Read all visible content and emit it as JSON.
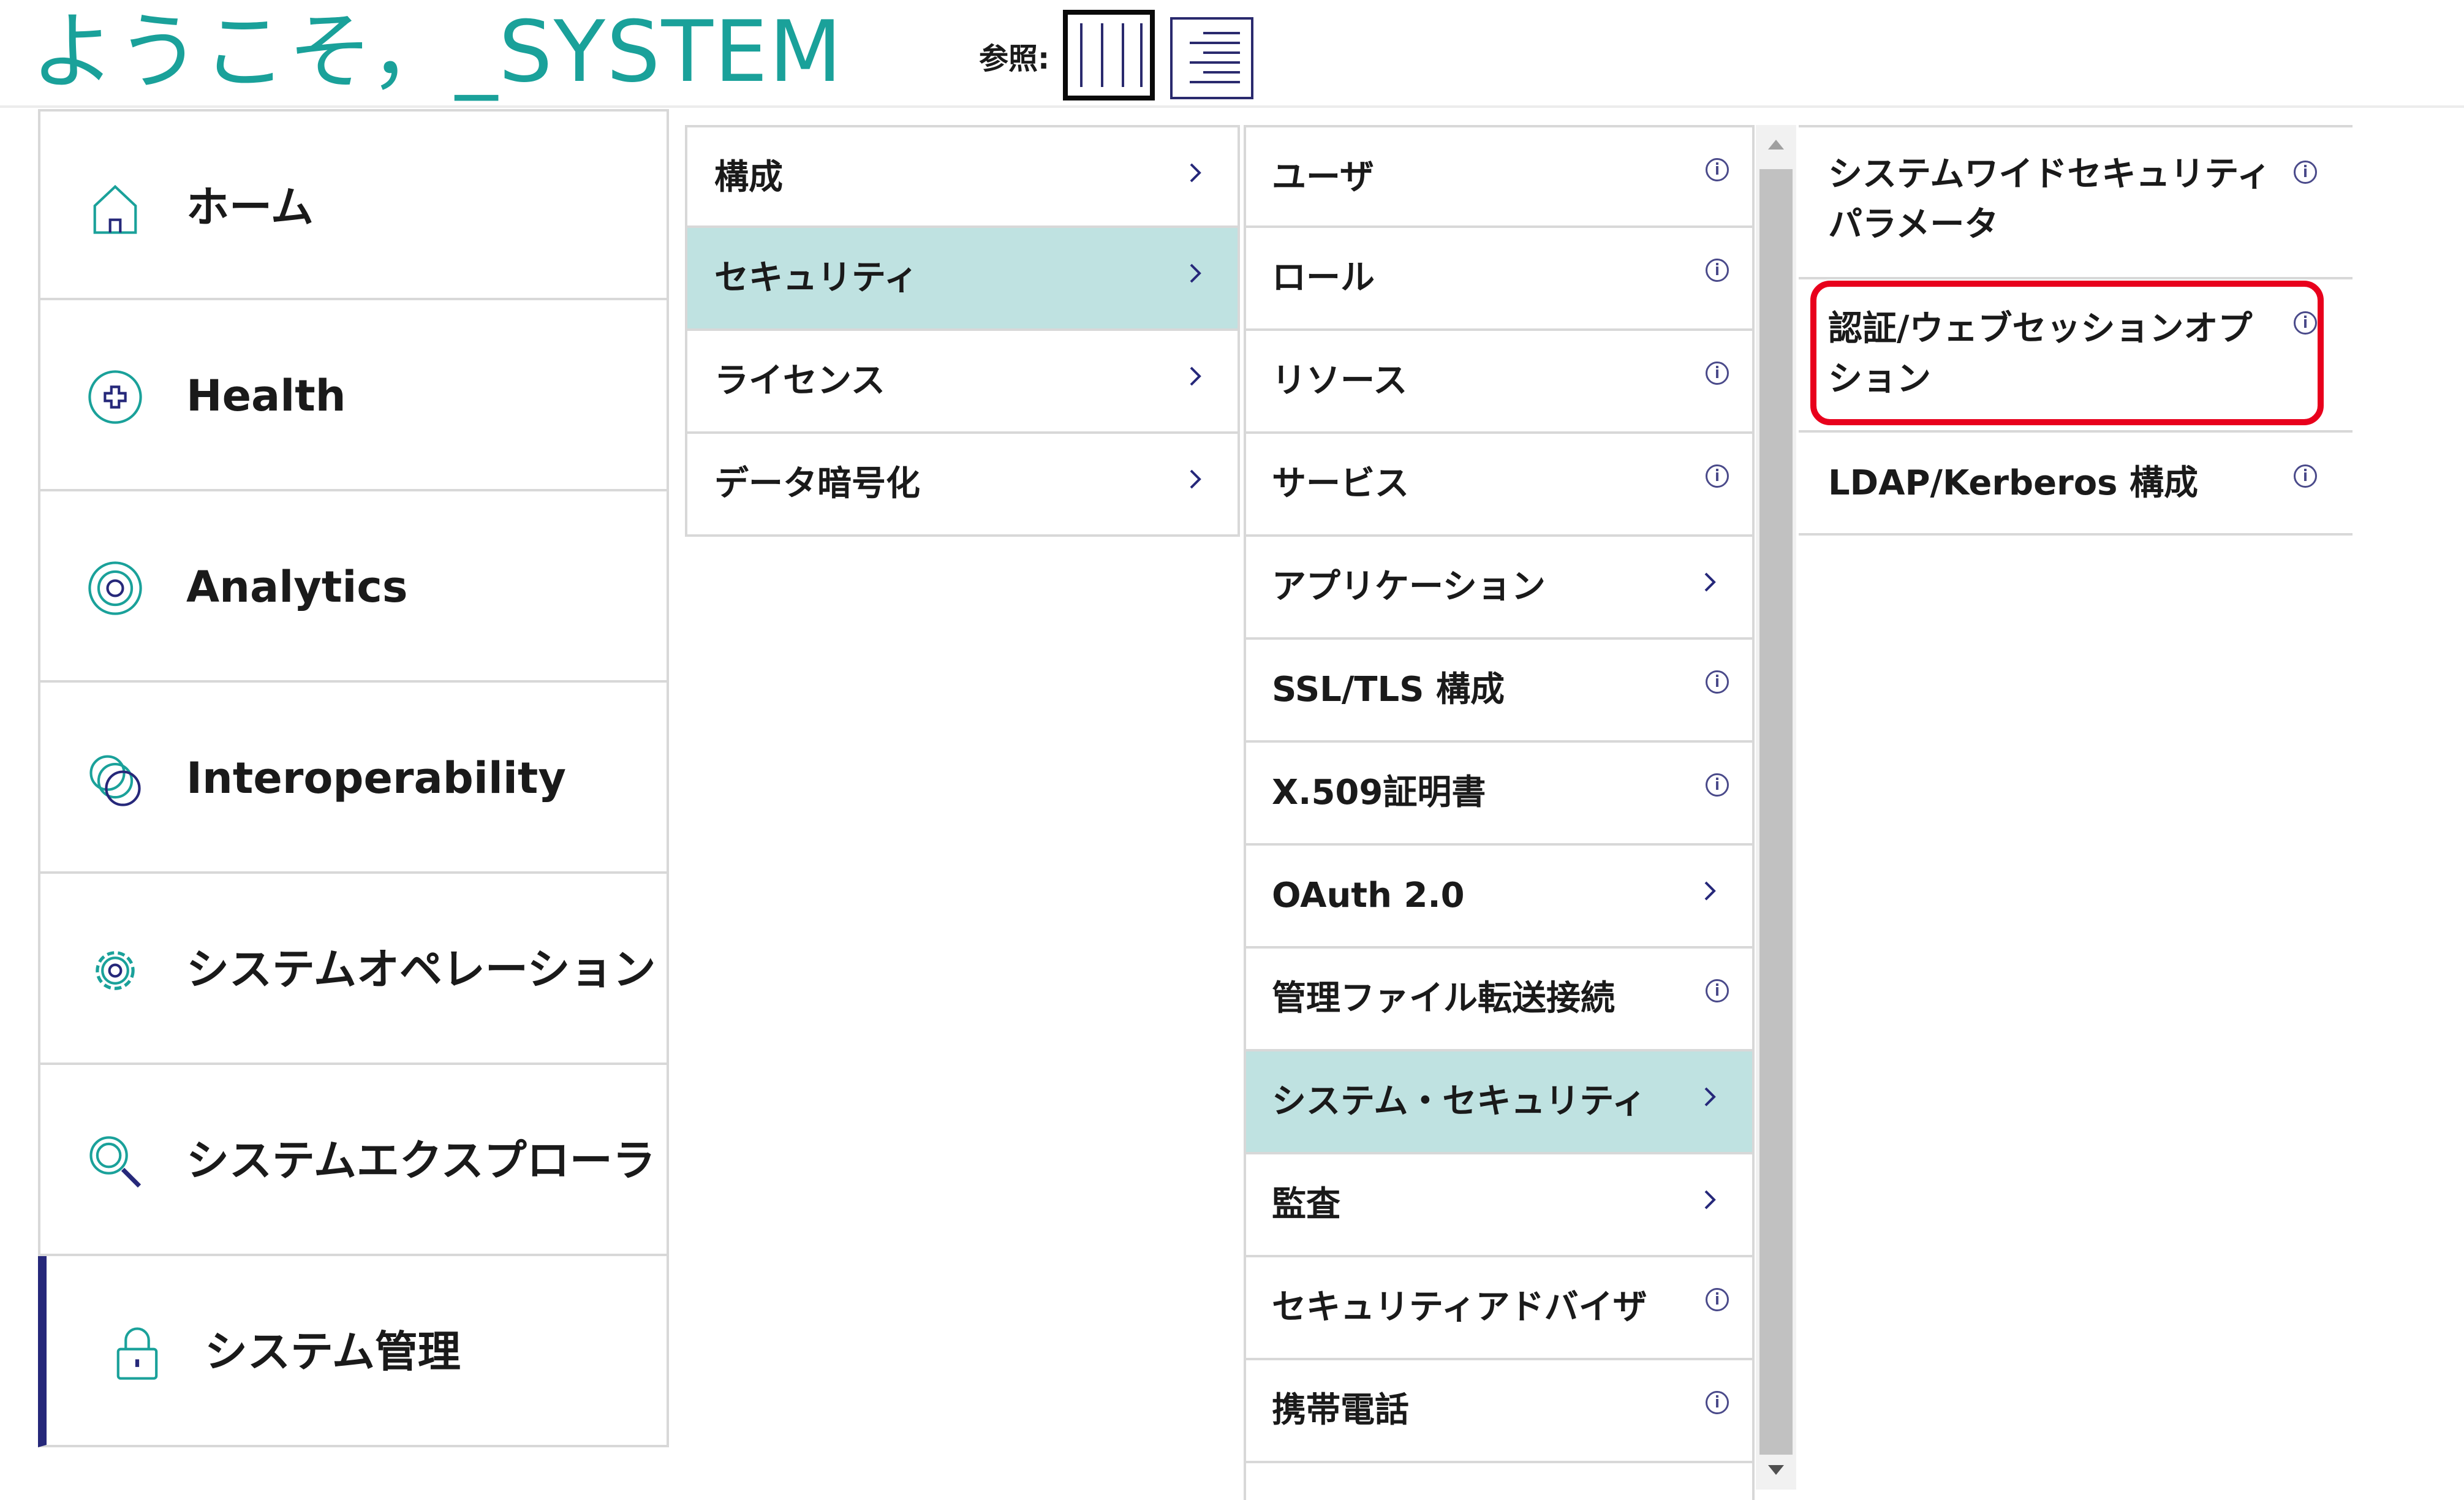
{
  "header": {
    "welcome": "ようこそ，_SYSTEM",
    "view_label": "参照:",
    "view_options": [
      "columns-view",
      "list-view"
    ],
    "selected_view": "columns-view"
  },
  "colors": {
    "brand_teal": "#1aa19a",
    "selected_bg": "#bfe2e1",
    "accent_navy": "#26287a",
    "highlight_red": "#e8001c"
  },
  "nav": {
    "items": [
      {
        "label": "ホーム",
        "icon": "home-icon"
      },
      {
        "label": "Health",
        "icon": "health-icon"
      },
      {
        "label": "Analytics",
        "icon": "analytics-icon"
      },
      {
        "label": "Interoperability",
        "icon": "interoperability-icon"
      },
      {
        "label": "システムオペレーション",
        "icon": "gear-icon"
      },
      {
        "label": "システムエクスプローラ",
        "icon": "explorer-icon"
      },
      {
        "label": "システム管理",
        "icon": "lock-icon",
        "active": true
      }
    ]
  },
  "col2": {
    "items": [
      {
        "label": "構成",
        "indicator": "chevron-right-icon"
      },
      {
        "label": "セキュリティ",
        "indicator": "chevron-right-icon",
        "selected": true
      },
      {
        "label": "ライセンス",
        "indicator": "chevron-right-icon"
      },
      {
        "label": "データ暗号化",
        "indicator": "chevron-right-icon"
      }
    ]
  },
  "col3": {
    "items": [
      {
        "label": "ユーザ",
        "indicator": "info-icon"
      },
      {
        "label": "ロール",
        "indicator": "info-icon"
      },
      {
        "label": "リソース",
        "indicator": "info-icon"
      },
      {
        "label": "サービス",
        "indicator": "info-icon"
      },
      {
        "label": "アプリケーション",
        "indicator": "chevron-right-icon"
      },
      {
        "label": "SSL/TLS 構成",
        "indicator": "info-icon"
      },
      {
        "label": "X.509証明書",
        "indicator": "info-icon"
      },
      {
        "label": "OAuth 2.0",
        "indicator": "chevron-right-icon"
      },
      {
        "label": "管理ファイル転送接続",
        "indicator": "info-icon"
      },
      {
        "label": "システム・セキュリティ",
        "indicator": "chevron-right-icon",
        "selected": true
      },
      {
        "label": "監査",
        "indicator": "chevron-right-icon"
      },
      {
        "label": "セキュリティアドバイザ",
        "indicator": "info-icon"
      },
      {
        "label": "携帯電話",
        "indicator": "info-icon"
      }
    ]
  },
  "col4": {
    "items": [
      {
        "label": "システムワイドセキュリティパラメータ",
        "indicator": "info-icon"
      },
      {
        "label": "認証/ウェブセッションオプション",
        "indicator": "info-icon",
        "highlighted": true
      },
      {
        "label": "LDAP/Kerberos 構成",
        "indicator": "info-icon"
      }
    ]
  }
}
